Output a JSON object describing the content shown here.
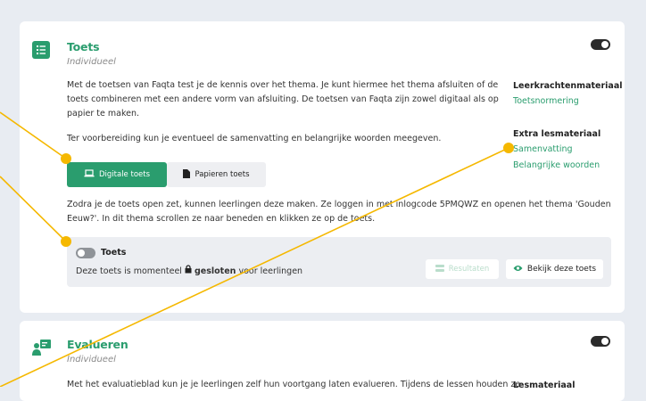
{
  "colors": {
    "accent": "#2a9d6e",
    "annotation": "#f5b800",
    "background": "#e8ecf2"
  },
  "toets": {
    "icon": "list-icon",
    "title": "Toets",
    "subtitle": "Individueel",
    "para1_l1": "Met de toetsen van Faqta test je de kennis over het thema. Je kunt hiermee het thema afsluiten of de",
    "para1_l2": "toets combineren met een andere vorm van afsluiting. De toetsen van Faqta zijn zowel digitaal als op",
    "para1_l3": "papier te maken.",
    "para2": "Ter voorbereiding kun je eventueel de samenvatting en belangrijke woorden meegeven.",
    "btn_digital": "Digitale toets",
    "btn_paper": "Papieren toets",
    "para3_l1": "Zodra je de toets open zet, kunnen leerlingen deze maken. Ze loggen in met inlogcode 5PMQWZ en openen het thema 'Gouden",
    "para3_l2": "Eeuw?'. In dit thema scrollen ze naar beneden en klikken ze op de toets.",
    "side": {
      "teacher_heading": "Leerkrachtenmateriaal",
      "teacher_link": "Toetsnormering",
      "extra_heading": "Extra lesmateriaal",
      "extra_link1": "Samenvatting",
      "extra_link2": "Belangrijke woorden"
    },
    "panel": {
      "title": "Toets",
      "status_pre": "Deze toets is momenteel",
      "status_bold": "gesloten",
      "status_post": "voor leerlingen",
      "results": "Resultaten",
      "view": "Bekijk deze toets"
    }
  },
  "evalueren": {
    "icon": "presenter-icon",
    "title": "Evalueren",
    "subtitle": "Individueel",
    "para_l1": "Met het evaluatieblad kun je je leerlingen zelf hun voortgang laten evalueren. Tijdens de lessen houden ze",
    "side_heading": "Lesmateriaal"
  }
}
